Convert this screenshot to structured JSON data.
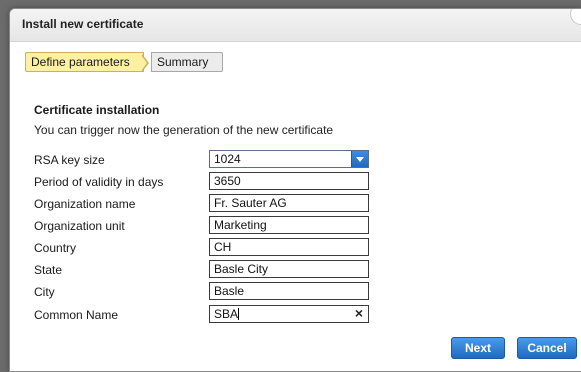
{
  "dialog": {
    "title": "Install new certificate"
  },
  "steps": [
    {
      "label": "Define parameters",
      "active": true
    },
    {
      "label": "Summary",
      "active": false
    }
  ],
  "section": {
    "title": "Certificate installation",
    "description": "You can trigger now the generation of the new certificate"
  },
  "fields": {
    "rsa_key_size": {
      "label": "RSA key size",
      "value": "1024"
    },
    "validity_days": {
      "label": "Period of validity in days",
      "value": "3650"
    },
    "organization_name": {
      "label": "Organization name",
      "value": "Fr. Sauter AG"
    },
    "organization_unit": {
      "label": "Organization unit",
      "value": "Marketing"
    },
    "country": {
      "label": "Country",
      "value": "CH"
    },
    "state": {
      "label": "State",
      "value": "Basle City"
    },
    "city": {
      "label": "City",
      "value": "Basle"
    },
    "common_name": {
      "label": "Common Name",
      "value": "SBA"
    }
  },
  "icons": {
    "clear": "×",
    "dropdown": "chevron-down-icon"
  },
  "buttons": {
    "next": "Next",
    "cancel": "Cancel"
  },
  "colors": {
    "accent": "#1e6ac2",
    "active_step": "#fdf0a0"
  }
}
